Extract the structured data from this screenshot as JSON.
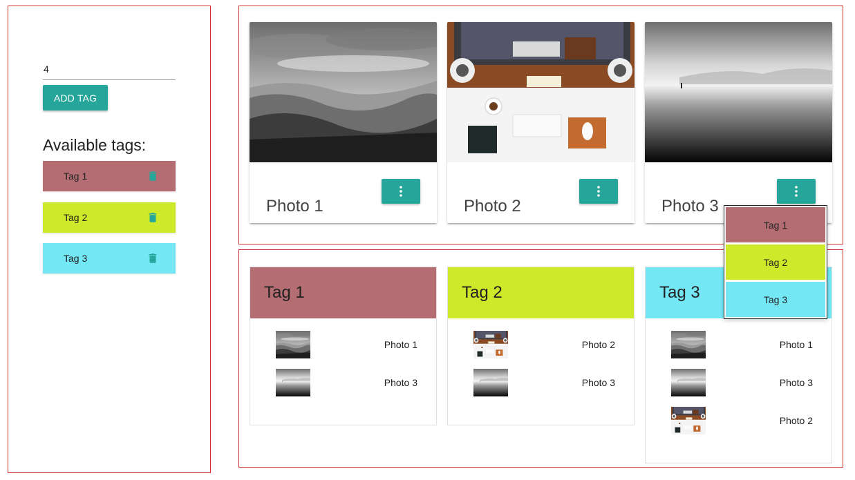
{
  "sidebar": {
    "tag_input_value": "4",
    "add_tag_label": "ADD TAG",
    "available_title": "Available tags:",
    "tags": [
      {
        "label": "Tag 1",
        "color": "#b56d74"
      },
      {
        "label": "Tag 2",
        "color": "#cee92a"
      },
      {
        "label": "Tag 3",
        "color": "#74e7f5"
      }
    ]
  },
  "gallery": {
    "photos": [
      {
        "title": "Photo 1"
      },
      {
        "title": "Photo 2"
      },
      {
        "title": "Photo 3"
      }
    ]
  },
  "dropdown": {
    "items": [
      {
        "label": "Tag 1"
      },
      {
        "label": "Tag 2"
      },
      {
        "label": "Tag 3"
      }
    ]
  },
  "tagboard": {
    "groups": [
      {
        "title": "Tag 1",
        "photos": [
          "Photo 1",
          "Photo 3"
        ]
      },
      {
        "title": "Tag 2",
        "photos": [
          "Photo 2",
          "Photo 3"
        ]
      },
      {
        "title": "Tag 3",
        "photos": [
          "Photo 1",
          "Photo 3",
          "Photo 2"
        ]
      }
    ]
  },
  "colors": {
    "accent": "#26a69a",
    "panel_border": "#d32f2f"
  },
  "icons": {
    "delete": "trash-icon",
    "menu": "more-vert-icon"
  }
}
